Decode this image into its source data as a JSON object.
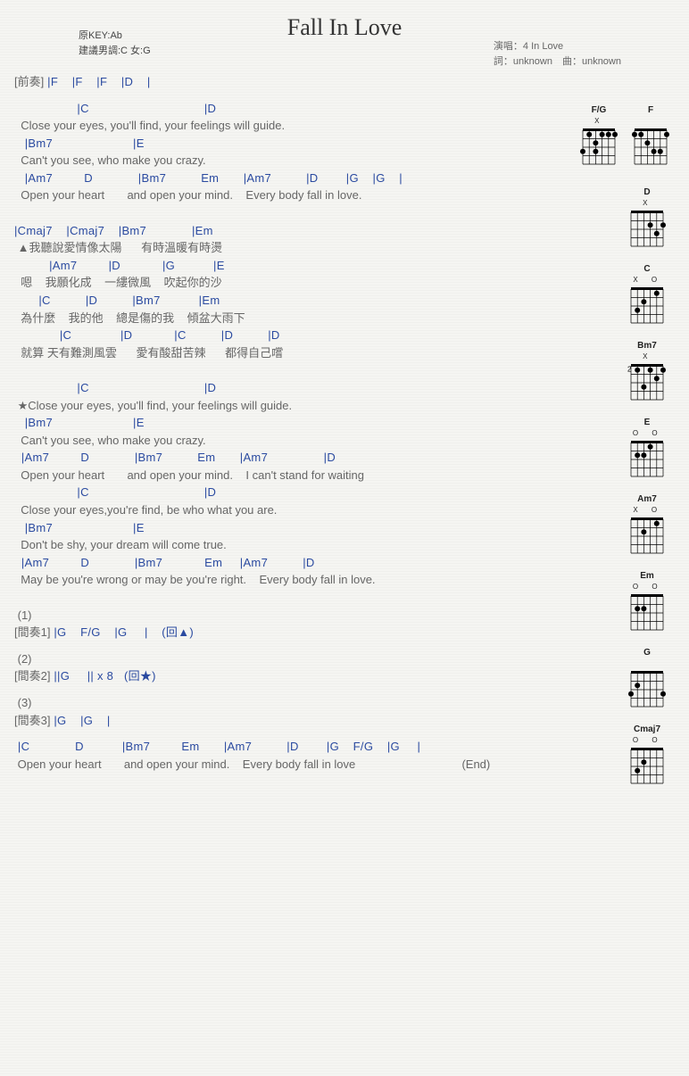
{
  "title": "Fall In Love",
  "meta_left_1": "原KEY:Ab",
  "meta_left_2": "建議男調:C 女:G",
  "meta_right_1": "演唱：4 In Love",
  "meta_right_2": "詞：unknown　曲：unknown",
  "intro_label": "[前奏]",
  "intro_chords": " |F    |F    |F    |D    |",
  "v1_c1": "                  |C                                 |D",
  "v1_l1": "  Close your eyes, you'll find, your feelings will guide.",
  "v1_c2": "   |Bm7                       |E",
  "v1_l2": "  Can't you see, who make you crazy.",
  "v1_c3": "   |Am7         D             |Bm7          Em       |Am7          |D        |G    |G    |",
  "v1_l3": "  Open your heart       and open your mind.    Every body fall in love.",
  "v2_c1": "|Cmaj7    |Cmaj7    |Bm7             |Em",
  "v2_l1": " ▲我聽說愛情像太陽      有時溫暖有時燙",
  "v2_c2": "          |Am7         |D            |G           |E",
  "v2_l2": "  嗯    我願化成    一縷微風    吹起你的沙",
  "v2_c3": "       |C          |D          |Bm7           |Em",
  "v2_l3": "  為什麼    我的他    總是傷的我    傾盆大雨下",
  "v2_c4": "             |C              |D            |C          |D          |D",
  "v2_l4": "  就算 天有難測風雲      愛有酸甜苦辣      都得自己嚐",
  "v3_c1": "                  |C                                 |D",
  "v3_l1": " ★Close your eyes, you'll find, your feelings will guide.",
  "v3_c2": "   |Bm7                       |E",
  "v3_l2": "  Can't you see, who make you crazy.",
  "v3_c3": "  |Am7         D             |Bm7          Em       |Am7                |D",
  "v3_l3": "  Open your heart       and open your mind.    I can't stand for waiting",
  "v3_c4": "                  |C                                 |D",
  "v3_l4": "  Close your eyes,you're find, be who what you are.",
  "v3_c5": "   |Bm7                       |E",
  "v3_l5": "  Don't be shy, your dream will come true.",
  "v3_c6": "  |Am7         D             |Bm7            Em     |Am7          |D",
  "v3_l6": "  May be you're wrong or may be you're right.    Every body fall in love.",
  "n1": " (1)",
  "inter1_label": "[間奏1]",
  "inter1_chords": " |G    F/G    |G     |    (回▲)",
  "n2": " (2)",
  "inter2_label": "[間奏2]",
  "inter2_chords": " ||G     || x 8   (回★)",
  "n3": " (3)",
  "inter3_label": "[間奏3]",
  "inter3_chords": " |G    |G    |",
  "end_c1": " |C             D           |Bm7         Em       |Am7          |D        |G    F/G    |G     |",
  "end_l1": " Open your heart       and open your mind.    Every body fall in love                                 (End)",
  "diagrams": [
    {
      "name": "F/G",
      "top": "X",
      "frets": [
        [
          3,
          0
        ],
        [
          1,
          1
        ],
        [
          2,
          2
        ],
        [
          3,
          2
        ],
        [
          1,
          3
        ],
        [
          1,
          4
        ],
        [
          1,
          5
        ]
      ]
    },
    {
      "name": "F",
      "top": "",
      "frets": [
        [
          1,
          0
        ],
        [
          1,
          1
        ],
        [
          2,
          2
        ],
        [
          3,
          3
        ],
        [
          3,
          4
        ],
        [
          1,
          5
        ]
      ]
    },
    {
      "name": "D",
      "top": "X",
      "frets": [
        [
          0,
          0
        ],
        [
          0,
          1
        ],
        [
          0,
          2
        ],
        [
          2,
          3
        ],
        [
          3,
          4
        ],
        [
          2,
          5
        ]
      ]
    },
    {
      "name": "C",
      "top": "X    O O",
      "frets": [
        [
          0,
          0
        ],
        [
          3,
          1
        ],
        [
          2,
          2
        ],
        [
          0,
          3
        ],
        [
          1,
          4
        ],
        [
          0,
          5
        ]
      ]
    },
    {
      "name": "Bm7",
      "top": "X",
      "side": "2",
      "frets": [
        [
          0,
          0
        ],
        [
          1,
          1
        ],
        [
          3,
          2
        ],
        [
          1,
          3
        ],
        [
          2,
          4
        ],
        [
          1,
          5
        ]
      ]
    },
    {
      "name": "E",
      "top": "O      O O",
      "frets": [
        [
          0,
          0
        ],
        [
          2,
          1
        ],
        [
          2,
          2
        ],
        [
          1,
          3
        ],
        [
          0,
          4
        ],
        [
          0,
          5
        ]
      ]
    },
    {
      "name": "Am7",
      "top": "X O  O  O",
      "frets": [
        [
          0,
          0
        ],
        [
          0,
          1
        ],
        [
          2,
          2
        ],
        [
          0,
          3
        ],
        [
          1,
          4
        ],
        [
          0,
          5
        ]
      ]
    },
    {
      "name": "Em",
      "top": "O    O O O",
      "frets": [
        [
          0,
          0
        ],
        [
          2,
          1
        ],
        [
          2,
          2
        ],
        [
          0,
          3
        ],
        [
          0,
          4
        ],
        [
          0,
          5
        ]
      ]
    },
    {
      "name": "G",
      "top": "",
      "frets": [
        [
          3,
          0
        ],
        [
          2,
          1
        ],
        [
          0,
          2
        ],
        [
          0,
          3
        ],
        [
          0,
          4
        ],
        [
          3,
          5
        ]
      ]
    },
    {
      "name": "Cmaj7",
      "top": "       O O",
      "frets": [
        [
          0,
          0
        ],
        [
          3,
          1
        ],
        [
          2,
          2
        ],
        [
          0,
          3
        ],
        [
          0,
          4
        ],
        [
          0,
          5
        ]
      ]
    }
  ]
}
